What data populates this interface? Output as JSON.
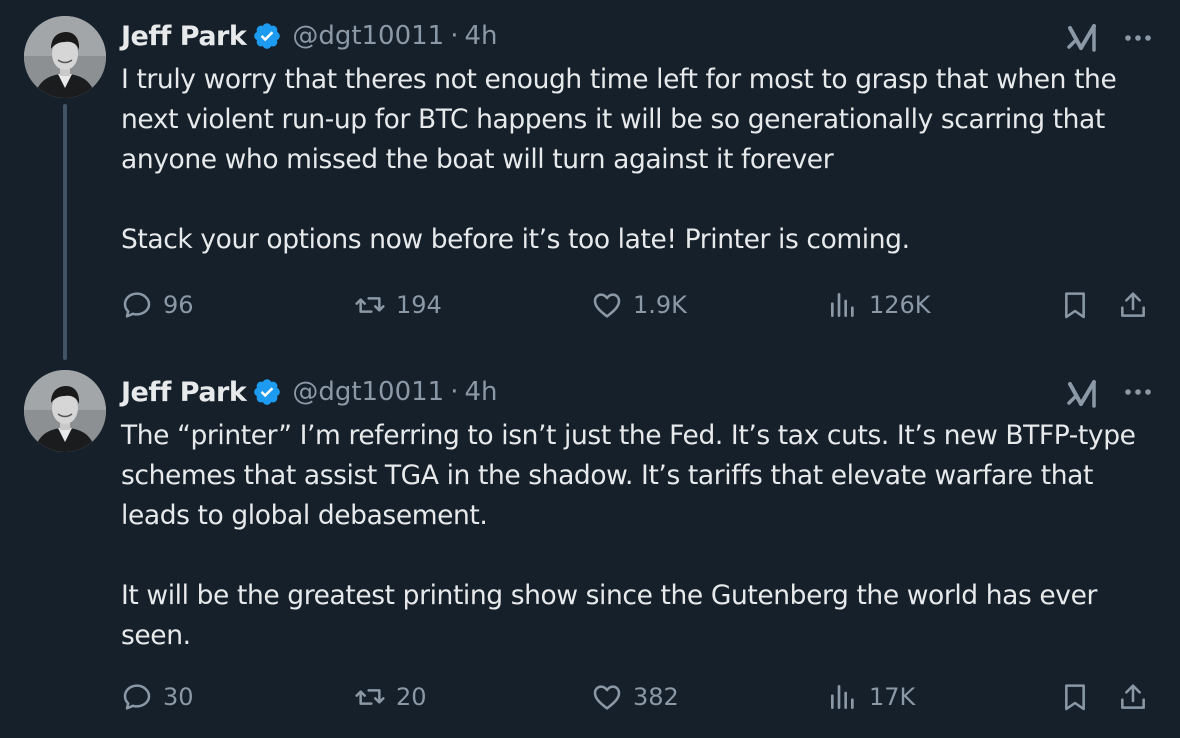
{
  "tweets": [
    {
      "author_name": "Jeff Park",
      "handle": "@dgt10011",
      "separator": "·",
      "time": "4h",
      "paragraphs": [
        "I truly worry that theres not enough time left for most to grasp that when the next violent run-up for BTC happens it will be so generationally scarring that anyone who missed the boat will turn against it forever",
        "Stack your options now before it’s too late! Printer is coming."
      ],
      "replies": "96",
      "reposts": "194",
      "likes": "1.9K",
      "views": "126K"
    },
    {
      "author_name": "Jeff Park",
      "handle": "@dgt10011",
      "separator": "·",
      "time": "4h",
      "paragraphs": [
        "The “printer” I’m referring to isn’t just the Fed. It’s tax cuts. It’s new BTFP-type schemes that assist TGA in the shadow. It’s tariffs that elevate warfare that leads to global debasement.",
        "It will be the greatest printing show since the Gutenberg the world has ever seen."
      ],
      "replies": "30",
      "reposts": "20",
      "likes": "382",
      "views": "17K"
    }
  ],
  "icons": {
    "verified": "verified-badge-icon",
    "grok": "grok-icon",
    "more": "more-icon",
    "reply": "reply-icon",
    "repost": "repost-icon",
    "like": "heart-icon",
    "views": "views-icon",
    "bookmark": "bookmark-icon",
    "share": "share-icon"
  },
  "colors": {
    "background": "#15202b",
    "text": "#e7e9ea",
    "secondary": "#8b98a5",
    "verified": "#1d9bf0",
    "thread_line": "#425364"
  }
}
